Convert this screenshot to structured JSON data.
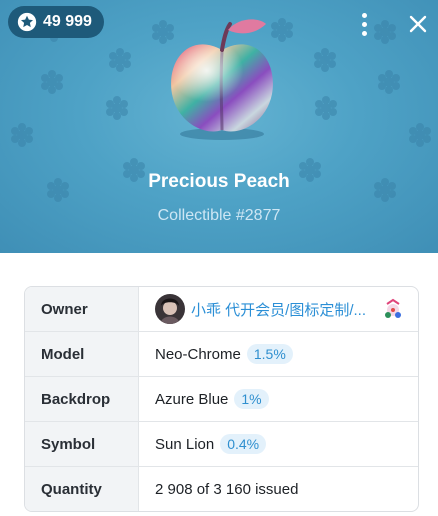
{
  "header": {
    "stars_balance": "49 999",
    "title": "Precious Peach",
    "subtitle": "Collectible #2877",
    "background_color": "#4ea2c6",
    "icons": [
      "star-icon",
      "more-vertical-icon",
      "close-icon"
    ]
  },
  "details": {
    "rows": [
      {
        "label": "Owner",
        "value": "小乖 代开会员/图标定制/..."
      },
      {
        "label": "Model",
        "value": "Neo-Chrome",
        "badge": "1.5%"
      },
      {
        "label": "Backdrop",
        "value": "Azure Blue",
        "badge": "1%"
      },
      {
        "label": "Symbol",
        "value": "Sun Lion",
        "badge": "0.4%"
      },
      {
        "label": "Quantity",
        "value": "2 908 of 3 160 issued"
      }
    ],
    "link_color": "#2b8fd6",
    "badge_color": "#2f8fcf"
  }
}
